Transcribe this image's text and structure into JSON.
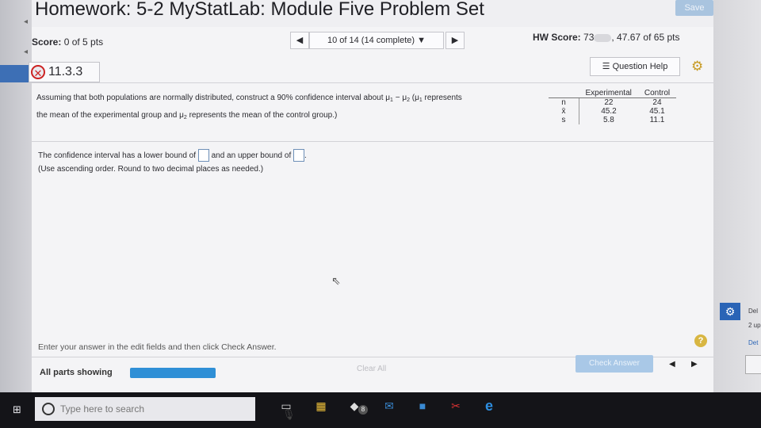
{
  "window": {
    "title": "Homework: 5-2 MyStatLab: Module Five Problem Set",
    "save_label": "Save"
  },
  "header": {
    "score_label": "Score:",
    "score_value": "0 of 5 pts",
    "prev_icon": "triangle-left-icon",
    "progress": "10 of 14 (14 complete) ▼",
    "next_icon": "triangle-right-icon",
    "hw_score_label": "HW Score:",
    "hw_score_value_start": "73",
    "hw_score_value_end": ", 47.67 of 65 pts"
  },
  "problem": {
    "id": "11.3.3",
    "status_icon": "x-circle-icon",
    "question_help": "Question Help"
  },
  "question": {
    "line1_a": "Assuming that both populations are normally distributed, construct a 90% confidence interval about μ",
    "mu1_sub": "1",
    "minus": " − μ",
    "mu2_sub": "2",
    "line1_b": " (μ",
    "mu1b_sub": "1",
    "line1_c": " represents",
    "line2_a": "the mean of the experimental group and μ",
    "mu2b_sub": "2",
    "line2_b": " represents the mean of the control group.)"
  },
  "stats_table": {
    "headers": [
      "",
      "Experimental",
      "Control"
    ],
    "rows": [
      {
        "label": "n",
        "experimental": "22",
        "control": "24"
      },
      {
        "label": "x̄",
        "experimental": "45.2",
        "control": "45.1"
      },
      {
        "label": "s",
        "experimental": "5.8",
        "control": "11.1"
      }
    ]
  },
  "answer": {
    "line1_a": "The confidence interval has a lower bound of",
    "line1_b": "and an upper bound of",
    "line1_c": ".",
    "line2": "(Use ascending order. Round to two decimal places as needed.)"
  },
  "footer": {
    "hint": "Enter your answer in the edit fields and then click Check Answer.",
    "parts_label": "All parts showing",
    "clear_all": "Clear All",
    "check_answer": "Check Answer",
    "help_icon": "?"
  },
  "sidebar_right": {
    "del_1": "Del",
    "del_2": "2 up",
    "del_3": "Det"
  },
  "taskbar": {
    "search_placeholder": "Type here to search",
    "store_badge": "8"
  }
}
